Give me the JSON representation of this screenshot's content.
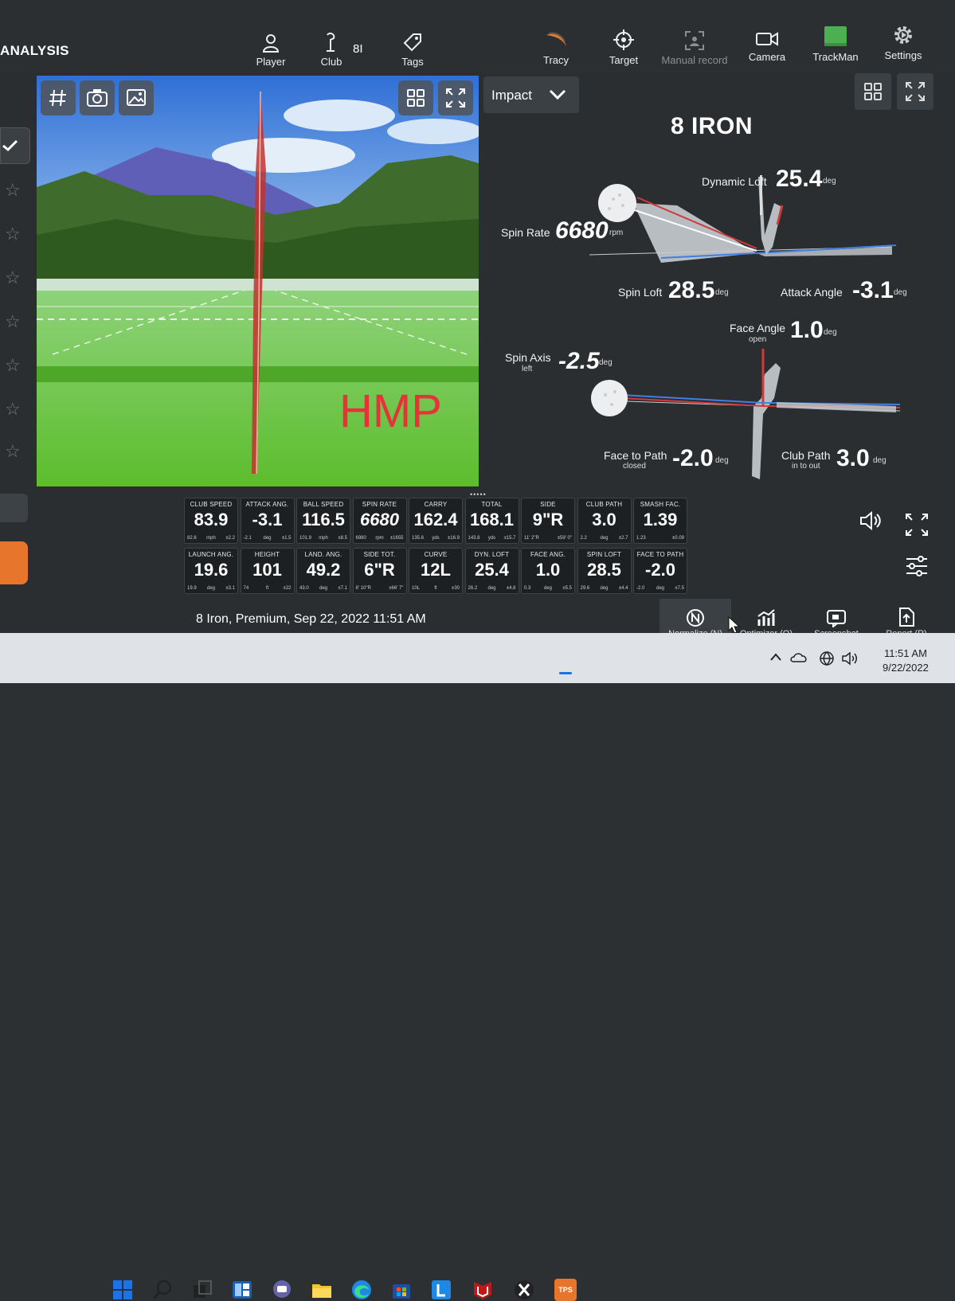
{
  "app": {
    "section_title": "ANALYSIS"
  },
  "nav": {
    "player": "Player",
    "club": "Club",
    "club_value": "8I",
    "tags": "Tags",
    "tracy": "Tracy",
    "target": "Target",
    "manual_record": "Manual record",
    "camera": "Camera",
    "trackman": "TrackMan",
    "settings": "Settings"
  },
  "video": {
    "overlay_text": "HMP"
  },
  "impact": {
    "dropdown_label": "Impact",
    "club_name": "8 IRON"
  },
  "metrics": {
    "dynamic_loft": {
      "label": "Dynamic Loft",
      "value": "25.4",
      "unit": "deg"
    },
    "spin_rate": {
      "label": "Spin Rate",
      "value": "6680",
      "unit": "rpm"
    },
    "spin_loft": {
      "label": "Spin Loft",
      "value": "28.5",
      "unit": "deg"
    },
    "attack_angle": {
      "label": "Attack Angle",
      "value": "-3.1",
      "unit": "deg"
    },
    "face_angle": {
      "label": "Face Angle",
      "sub": "open",
      "value": "1.0",
      "unit": "deg"
    },
    "spin_axis": {
      "label": "Spin Axis",
      "sub": "left",
      "value": "-2.5",
      "unit": "deg"
    },
    "face_to_path": {
      "label": "Face to Path",
      "sub": "closed",
      "value": "-2.0",
      "unit": "deg"
    },
    "club_path": {
      "label": "Club Path",
      "sub": "in to out",
      "value": "3.0",
      "unit": "deg"
    }
  },
  "tiles_row1": [
    {
      "title": "CLUB SPEED",
      "value": "83.9",
      "a": "82.6",
      "b": "mph",
      "c": "±2.2"
    },
    {
      "title": "ATTACK ANG.",
      "value": "-3.1",
      "a": "-2.1",
      "b": "deg",
      "c": "±1.5"
    },
    {
      "title": "BALL SPEED",
      "value": "116.5",
      "a": "101.9",
      "b": "mph",
      "c": "±8.5"
    },
    {
      "title": "SPIN RATE",
      "value": "6680",
      "a": "6980",
      "b": "rpm",
      "c": "±1655"
    },
    {
      "title": "CARRY",
      "value": "162.4",
      "a": "135.6",
      "b": "yds",
      "c": "±16.9"
    },
    {
      "title": "TOTAL",
      "value": "168.1",
      "a": "143.8",
      "b": "yds",
      "c": "±15.7"
    },
    {
      "title": "SIDE",
      "value": "9\"R",
      "a": "11' 2\"R",
      "b": "",
      "c": "±59' 0\""
    },
    {
      "title": "CLUB PATH",
      "value": "3.0",
      "a": "2.2",
      "b": "deg",
      "c": "±2.7"
    },
    {
      "title": "SMASH FAC.",
      "value": "1.39",
      "a": "1.23",
      "b": "",
      "c": "±0.09"
    }
  ],
  "tiles_row2": [
    {
      "title": "LAUNCH ANG.",
      "value": "19.6",
      "a": "19.9",
      "b": "deg",
      "c": "±3.1"
    },
    {
      "title": "HEIGHT",
      "value": "101",
      "a": "74",
      "b": "ft",
      "c": "±22"
    },
    {
      "title": "LAND. ANG.",
      "value": "49.2",
      "a": "43.0",
      "b": "deg",
      "c": "±7.1"
    },
    {
      "title": "SIDE TOT.",
      "value": "6\"R",
      "a": "8' 10\"R",
      "b": "",
      "c": "±66' 7\""
    },
    {
      "title": "CURVE",
      "value": "12L",
      "a": "10L",
      "b": "ft",
      "c": "±30"
    },
    {
      "title": "DYN. LOFT",
      "value": "25.4",
      "a": "26.2",
      "b": "deg",
      "c": "±4.8"
    },
    {
      "title": "FACE ANG.",
      "value": "1.0",
      "a": "0.3",
      "b": "deg",
      "c": "±5.5"
    },
    {
      "title": "SPIN LOFT",
      "value": "28.5",
      "a": "29.6",
      "b": "deg",
      "c": "±4.4"
    },
    {
      "title": "FACE TO PATH",
      "value": "-2.0",
      "a": "-2.0",
      "b": "deg",
      "c": "±7.5"
    }
  ],
  "shot_info": "8 Iron, Premium, Sep 22, 2022 11:51 AM",
  "bottom": {
    "normalize": "Normalize (N)",
    "optimizer": "Optimizer (O)",
    "screenshot": "Screenshot",
    "report": "Report (R)"
  },
  "taskbar": {
    "time": "11:51 AM",
    "date": "9/22/2022",
    "tps_label": "TPS"
  }
}
